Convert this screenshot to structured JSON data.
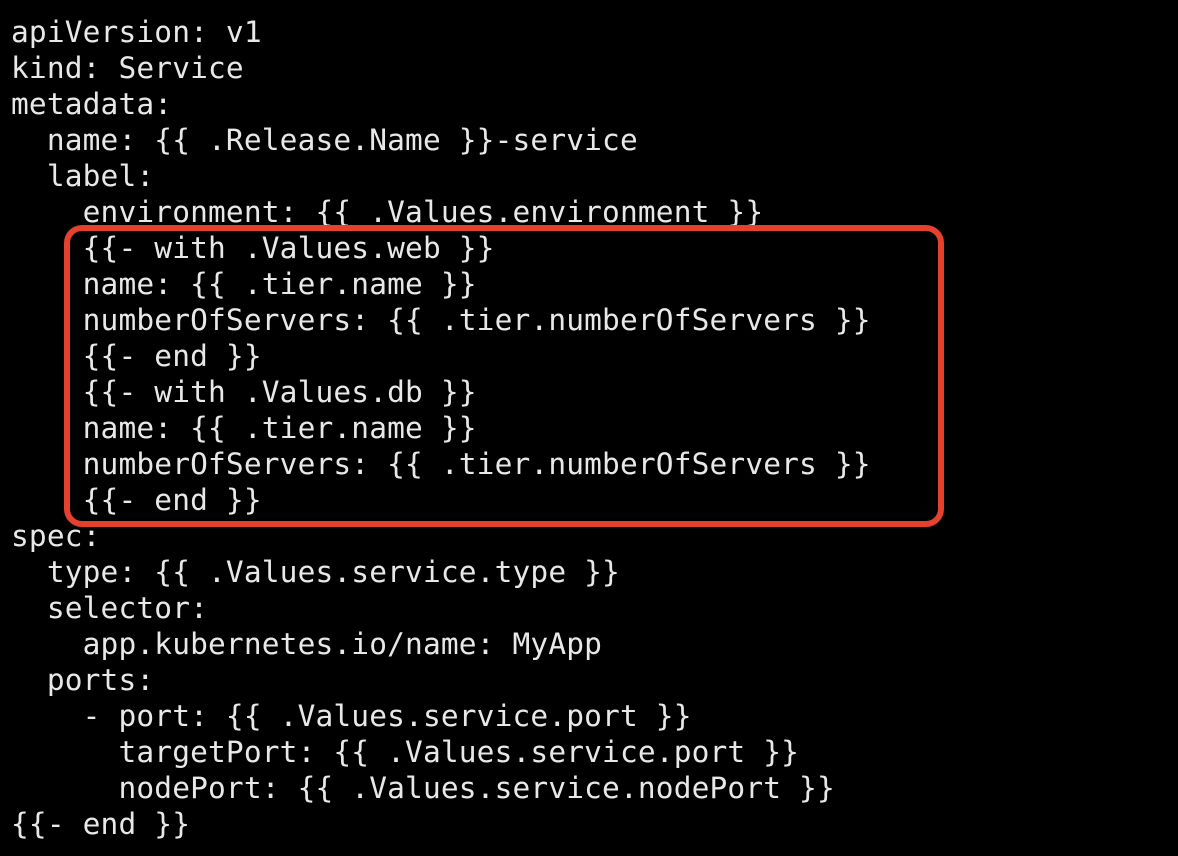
{
  "editor": {
    "lines": [
      "apiVersion: v1",
      "kind: Service",
      "metadata:",
      "  name: {{ .Release.Name }}-service",
      "  label:",
      "    environment: {{ .Values.environment }}",
      "    {{- with .Values.web }}",
      "    name: {{ .tier.name }}",
      "    numberOfServers: {{ .tier.numberOfServers }}",
      "    {{- end }}",
      "    {{- with .Values.db }}",
      "    name: {{ .tier.name }}",
      "    numberOfServers: {{ .tier.numberOfServers }}",
      "    {{- end }}",
      "spec:",
      "  type: {{ .Values.service.type }}",
      "  selector:",
      "    app.kubernetes.io/name: MyApp",
      "  ports:",
      "    - port: {{ .Values.service.port }}",
      "      targetPort: {{ .Values.service.port }}",
      "      nodePort: {{ .Values.service.nodePort }}",
      "{{- end }}"
    ],
    "highlight_color": "#e5412f",
    "background_color": "#000000",
    "text_color": "#e8e8e8"
  }
}
